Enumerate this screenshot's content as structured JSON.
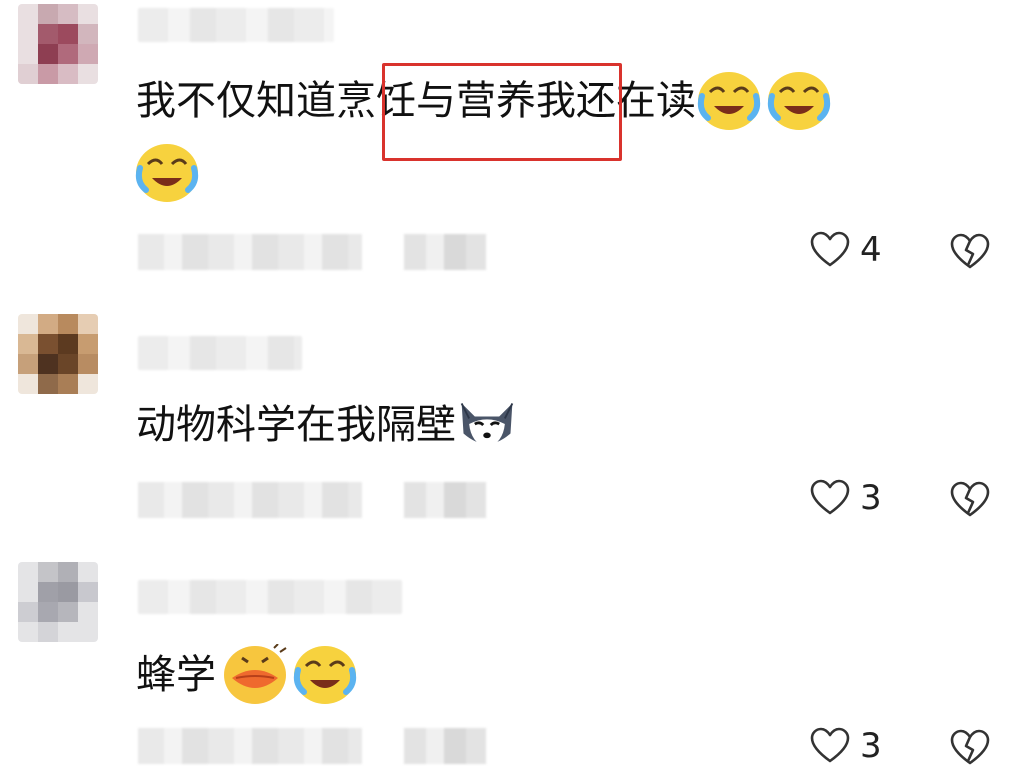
{
  "comments": [
    {
      "text_before": "我不仅知道 ",
      "highlighted": "烹饪与营养",
      "text_after": "我还在读",
      "emojis": [
        "laugh-cry-emoji",
        "laugh-cry-emoji",
        "laugh-cry-emoji"
      ],
      "likes": "4"
    },
    {
      "text": "动物科学在我隔壁",
      "emojis": [
        "husky-dog-emoji"
      ],
      "likes": "3"
    },
    {
      "text": "蜂学",
      "emojis": [
        "kiss-lips-emoji",
        "laugh-cry-emoji"
      ],
      "likes": "3"
    }
  ],
  "colors": {
    "highlight_border": "#d9332d",
    "text": "#111111",
    "icon": "#333333"
  },
  "icons": {
    "like": "heart-outline-icon",
    "dislike": "broken-heart-icon"
  }
}
